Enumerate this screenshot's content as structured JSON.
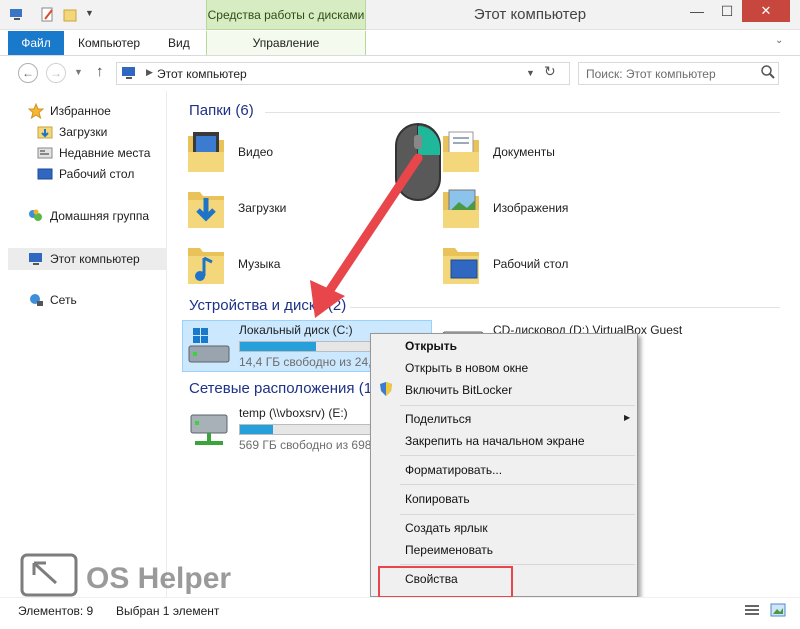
{
  "titlebar": {
    "context_tab_title": "Средства работы с дисками",
    "window_title": "Этот компьютер",
    "minimize_glyph": "—",
    "maximize_glyph": "☐",
    "close_glyph": "✕"
  },
  "ribbon": {
    "tabs": {
      "file": "Файл",
      "computer": "Компьютер",
      "view": "Вид",
      "manage": "Управление"
    },
    "expand_glyph": "⌄",
    "help_glyph": "?"
  },
  "address": {
    "path": "Этот компьютер",
    "search_placeholder": "Поиск: Этот компьютер"
  },
  "nav_pane": {
    "favorites": "Избранное",
    "downloads": "Загрузки",
    "recent": "Недавние места",
    "desktop": "Рабочий стол",
    "homegroup": "Домашняя группа",
    "this_pc": "Этот компьютер",
    "network": "Сеть"
  },
  "groups": {
    "folders_title": "Папки (6)",
    "devices_title": "Устройства и диски (2)",
    "network_title": "Сетевые расположения (1)"
  },
  "folders": {
    "video": "Видео",
    "documents": "Документы",
    "downloads": "Загрузки",
    "images": "Изображения",
    "music": "Музыка",
    "desktop": "Рабочий стол"
  },
  "drives": {
    "c_label": "Локальный диск (C:)",
    "c_free": "14,4 ГБ свободно из 24,6 ГБ",
    "c_used_fraction": 0.41,
    "d_label": "CD-дисковод (D:) VirtualBox Guest",
    "net_label": "temp (\\\\vboxsrv) (E:)",
    "net_free": "569 ГБ свободно из 698 ГБ",
    "net_used_fraction": 0.18
  },
  "context_menu": {
    "open": "Открыть",
    "open_new_window": "Открыть в новом окне",
    "bitlocker": "Включить BitLocker",
    "share": "Поделиться",
    "pin_start": "Закрепить на начальном экране",
    "format": "Форматировать...",
    "copy": "Копировать",
    "create_shortcut": "Создать ярлык",
    "rename": "Переименовать",
    "properties": "Свойства"
  },
  "status": {
    "items_count": "Элементов: 9",
    "selected": "Выбран 1 элемент"
  },
  "watermark": {
    "text": "OS Helper"
  },
  "colors": {
    "accent": "#1979ca",
    "drive_bar": "#26a0da",
    "highlight_red": "#e8464a",
    "context_tab_green": "#d8ecc4"
  },
  "icons": [
    "computer-icon",
    "star-icon",
    "folder-icon",
    "drive-icon",
    "network-icon",
    "homegroup-icon",
    "shield-icon",
    "mouse-icon"
  ]
}
